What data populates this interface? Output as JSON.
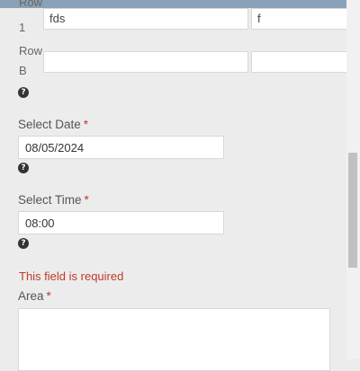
{
  "grid": {
    "rows": [
      {
        "label_line1": "Row",
        "label_line2": "1",
        "cells": [
          "fds",
          "f"
        ]
      },
      {
        "label_line1": "Row",
        "label_line2": "B",
        "cells": [
          "",
          ""
        ]
      }
    ]
  },
  "help_icon_glyph": "?",
  "date_field": {
    "label": "Select Date",
    "required_mark": "*",
    "value": "08/05/2024"
  },
  "time_field": {
    "label": "Select Time",
    "required_mark": "*",
    "value": "08:00"
  },
  "area_field": {
    "error": "This field is required",
    "label": "Area",
    "required_mark": "*",
    "value": ""
  },
  "colors": {
    "accent": "#8aa2b7",
    "error": "#c0392b",
    "background": "#ececec"
  }
}
